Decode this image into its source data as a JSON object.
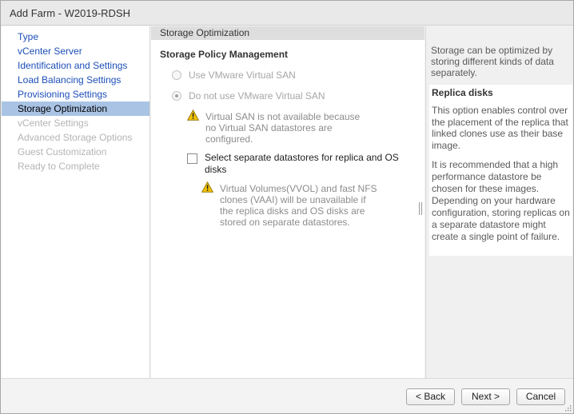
{
  "window": {
    "title": "Add Farm - W2019-RDSH"
  },
  "sidebar": {
    "items": [
      {
        "label": "Type",
        "state": "link"
      },
      {
        "label": "vCenter Server",
        "state": "link"
      },
      {
        "label": "Identification and Settings",
        "state": "link"
      },
      {
        "label": "Load Balancing Settings",
        "state": "link"
      },
      {
        "label": "Provisioning Settings",
        "state": "link"
      },
      {
        "label": "Storage Optimization",
        "state": "active"
      },
      {
        "label": "vCenter Settings",
        "state": "disabled"
      },
      {
        "label": "Advanced Storage Options",
        "state": "disabled"
      },
      {
        "label": "Guest Customization",
        "state": "disabled"
      },
      {
        "label": "Ready to Complete",
        "state": "disabled"
      }
    ]
  },
  "main": {
    "section_title": "Storage Optimization",
    "policy_title": "Storage Policy Management",
    "radio_use_vsan": {
      "label": "Use VMware Virtual SAN",
      "selected": false,
      "enabled": false
    },
    "radio_no_vsan": {
      "label": "Do not use VMware Virtual SAN",
      "selected": true,
      "enabled": false
    },
    "vsan_warning": {
      "line1": "Virtual SAN is not available because",
      "line2": "no Virtual SAN datastores are",
      "line3": "configured."
    },
    "separate_datastores": {
      "label": "Select separate datastores for replica and OS disks",
      "checked": false
    },
    "vvol_warning": {
      "line1": "Virtual Volumes(VVOL) and fast NFS",
      "line2": "clones (VAAI) will be unavailable if",
      "line3": "the replica disks and OS disks are",
      "line4": "stored on separate datastores."
    }
  },
  "help": {
    "intro": "Storage can be optimized by storing different kinds of data separately.",
    "title": "Replica disks",
    "p1": "This option enables control over the placement of the replica that linked clones use as their base image.",
    "p2": "It is recommended that a high performance datastore be chosen for these images. Depending on your hardware configuration, storing replicas on a separate datastore might create a single point of failure."
  },
  "footer": {
    "back_label": "< Back",
    "next_label": "Next >",
    "cancel_label": "Cancel"
  },
  "colors": {
    "link": "#1d4fb8",
    "active_bg": "#a9c3e4",
    "disabled": "#b4b4b4",
    "warning": "#f2c200"
  },
  "icons": {
    "warning": "warning-triangle-icon",
    "grip": "resize-grip-icon"
  }
}
